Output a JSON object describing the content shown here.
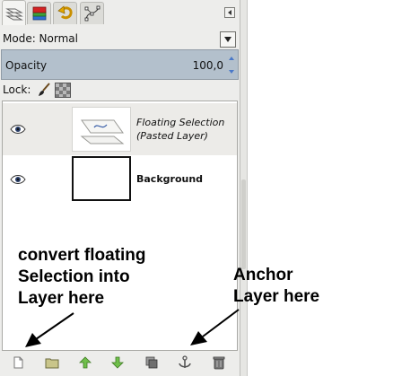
{
  "tabs": [
    {
      "name": "layers",
      "icon": "layers-icon"
    },
    {
      "name": "channels",
      "icon": "channels-icon"
    },
    {
      "name": "undo-history",
      "icon": "undo-history-icon"
    },
    {
      "name": "paths",
      "icon": "paths-icon"
    }
  ],
  "mode": {
    "label": "Mode: Normal"
  },
  "opacity": {
    "label": "Opacity",
    "value": "100,0"
  },
  "lock": {
    "label": "Lock:"
  },
  "layers": [
    {
      "name_line1": "Floating Selection",
      "name_line2": "(Pasted Layer)",
      "visible": true,
      "selected": true
    },
    {
      "name_line1": "Background",
      "visible": true,
      "selected": false
    }
  ],
  "annotations": {
    "convert": [
      "convert floating",
      "Selection into",
      "Layer here"
    ],
    "anchor": [
      "Anchor",
      "Layer here"
    ]
  },
  "bottom_buttons": [
    "new-layer-icon",
    "new-layer-group-icon",
    "raise-layer-icon",
    "lower-layer-icon",
    "duplicate-layer-icon",
    "anchor-layer-icon",
    "delete-layer-icon"
  ],
  "colors": {
    "opacity_bar": "#b3c0cc",
    "panel_bg": "#ededeb",
    "selected_row": "#ecebe8"
  }
}
